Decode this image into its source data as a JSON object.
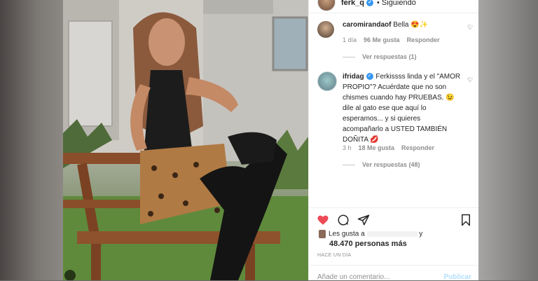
{
  "header": {
    "username": "ferk_q",
    "follow_label": "• Siguiendo"
  },
  "comments": [
    {
      "username": "caromirandaof",
      "text": " Bella 😍✨",
      "time": "1 día",
      "likes": "96 Me gusta",
      "reply_label": "Responder",
      "view_replies": "Ver respuestas (1)"
    },
    {
      "username": "ifridag",
      "text": " Ferkissss linda y el \"AMOR PROPIO\"? Acuérdate que no son chismes cuando hay PRUEBAS. 😉 dile al gato ese que aquí lo esperamos... y si quieres acompañarlo a USTED TAMBIÉN DOÑITA 💋",
      "time": "3 h",
      "likes": "18 Me gusta",
      "reply_label": "Responder",
      "view_replies": "Ver respuestas (48)"
    }
  ],
  "likes": {
    "prefix": "Les gusta a",
    "suffix": "y",
    "count": "48.470 personas más"
  },
  "date": "HACE UN DÍA",
  "add_comment": {
    "placeholder": "Añade un comentario...",
    "publish_label": "Publicar"
  },
  "icons": [
    "heart-icon",
    "comment-icon",
    "share-icon",
    "bookmark-icon",
    "verified-icon",
    "small-heart-icon"
  ],
  "colors": {
    "like_red": "#ed4956",
    "verified_blue": "#3897f0",
    "publish_disabled": "#b2dffc"
  }
}
